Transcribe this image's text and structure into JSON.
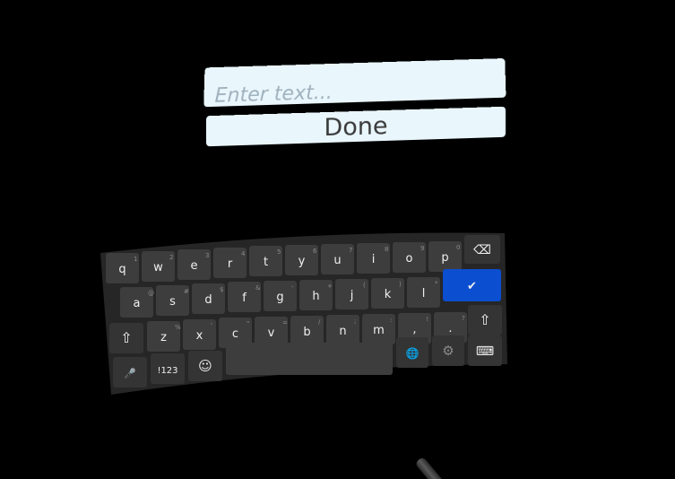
{
  "text_field": {
    "value": "",
    "placeholder": "Enter text..."
  },
  "done_button": {
    "label": "Done"
  },
  "keyboard": {
    "row1": [
      {
        "label": "q",
        "hint": "1"
      },
      {
        "label": "w",
        "hint": "2"
      },
      {
        "label": "e",
        "hint": "3"
      },
      {
        "label": "r",
        "hint": "4"
      },
      {
        "label": "t",
        "hint": "5"
      },
      {
        "label": "y",
        "hint": "6"
      },
      {
        "label": "u",
        "hint": "7"
      },
      {
        "label": "i",
        "hint": "8"
      },
      {
        "label": "o",
        "hint": "9"
      },
      {
        "label": "p",
        "hint": "0"
      }
    ],
    "row2": [
      {
        "label": "a",
        "hint": "@"
      },
      {
        "label": "s",
        "hint": "#"
      },
      {
        "label": "d",
        "hint": "$"
      },
      {
        "label": "f",
        "hint": "&"
      },
      {
        "label": "g",
        "hint": "-"
      },
      {
        "label": "h",
        "hint": "+"
      },
      {
        "label": "j",
        "hint": "("
      },
      {
        "label": "k",
        "hint": ")"
      },
      {
        "label": "l",
        "hint": "*"
      }
    ],
    "row3": [
      {
        "label": "z",
        "hint": "%"
      },
      {
        "label": "x",
        "hint": "'"
      },
      {
        "label": "c",
        "hint": "\""
      },
      {
        "label": "v",
        "hint": "="
      },
      {
        "label": "b",
        "hint": "/"
      },
      {
        "label": "n",
        "hint": ";"
      },
      {
        "label": "m",
        "hint": ":"
      },
      {
        "label": ",",
        "hint": "!"
      },
      {
        "label": ".",
        "hint": "?"
      }
    ],
    "symbols_label": "!123",
    "icons": {
      "backspace": "backspace-icon",
      "enter": "check-circle-icon",
      "shift": "shift-arrow-icon",
      "mic": "microphone-icon",
      "emoji": "emoji-icon",
      "globe": "globe-icon",
      "settings": "gear-icon",
      "hide": "keyboard-hide-icon"
    },
    "accent_color": "#0b4ed0",
    "key_color": "#3d3d3d"
  }
}
